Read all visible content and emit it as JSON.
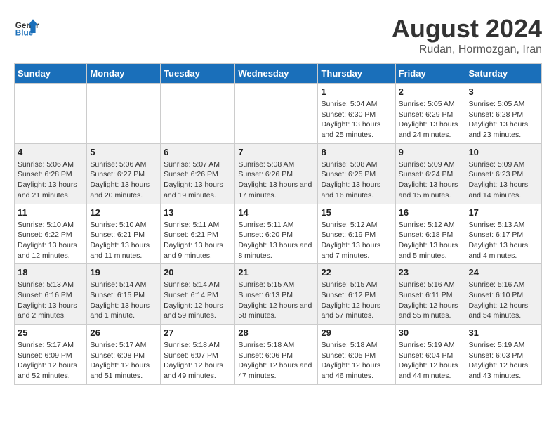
{
  "header": {
    "logo_line1": "General",
    "logo_line2": "Blue",
    "main_title": "August 2024",
    "subtitle": "Rudan, Hormozgan, Iran"
  },
  "calendar": {
    "weekdays": [
      "Sunday",
      "Monday",
      "Tuesday",
      "Wednesday",
      "Thursday",
      "Friday",
      "Saturday"
    ],
    "weeks": [
      [
        {
          "day": "",
          "info": ""
        },
        {
          "day": "",
          "info": ""
        },
        {
          "day": "",
          "info": ""
        },
        {
          "day": "",
          "info": ""
        },
        {
          "day": "1",
          "info": "Sunrise: 5:04 AM\nSunset: 6:30 PM\nDaylight: 13 hours and 25 minutes."
        },
        {
          "day": "2",
          "info": "Sunrise: 5:05 AM\nSunset: 6:29 PM\nDaylight: 13 hours and 24 minutes."
        },
        {
          "day": "3",
          "info": "Sunrise: 5:05 AM\nSunset: 6:28 PM\nDaylight: 13 hours and 23 minutes."
        }
      ],
      [
        {
          "day": "4",
          "info": "Sunrise: 5:06 AM\nSunset: 6:28 PM\nDaylight: 13 hours and 21 minutes."
        },
        {
          "day": "5",
          "info": "Sunrise: 5:06 AM\nSunset: 6:27 PM\nDaylight: 13 hours and 20 minutes."
        },
        {
          "day": "6",
          "info": "Sunrise: 5:07 AM\nSunset: 6:26 PM\nDaylight: 13 hours and 19 minutes."
        },
        {
          "day": "7",
          "info": "Sunrise: 5:08 AM\nSunset: 6:26 PM\nDaylight: 13 hours and 17 minutes."
        },
        {
          "day": "8",
          "info": "Sunrise: 5:08 AM\nSunset: 6:25 PM\nDaylight: 13 hours and 16 minutes."
        },
        {
          "day": "9",
          "info": "Sunrise: 5:09 AM\nSunset: 6:24 PM\nDaylight: 13 hours and 15 minutes."
        },
        {
          "day": "10",
          "info": "Sunrise: 5:09 AM\nSunset: 6:23 PM\nDaylight: 13 hours and 14 minutes."
        }
      ],
      [
        {
          "day": "11",
          "info": "Sunrise: 5:10 AM\nSunset: 6:22 PM\nDaylight: 13 hours and 12 minutes."
        },
        {
          "day": "12",
          "info": "Sunrise: 5:10 AM\nSunset: 6:21 PM\nDaylight: 13 hours and 11 minutes."
        },
        {
          "day": "13",
          "info": "Sunrise: 5:11 AM\nSunset: 6:21 PM\nDaylight: 13 hours and 9 minutes."
        },
        {
          "day": "14",
          "info": "Sunrise: 5:11 AM\nSunset: 6:20 PM\nDaylight: 13 hours and 8 minutes."
        },
        {
          "day": "15",
          "info": "Sunrise: 5:12 AM\nSunset: 6:19 PM\nDaylight: 13 hours and 7 minutes."
        },
        {
          "day": "16",
          "info": "Sunrise: 5:12 AM\nSunset: 6:18 PM\nDaylight: 13 hours and 5 minutes."
        },
        {
          "day": "17",
          "info": "Sunrise: 5:13 AM\nSunset: 6:17 PM\nDaylight: 13 hours and 4 minutes."
        }
      ],
      [
        {
          "day": "18",
          "info": "Sunrise: 5:13 AM\nSunset: 6:16 PM\nDaylight: 13 hours and 2 minutes."
        },
        {
          "day": "19",
          "info": "Sunrise: 5:14 AM\nSunset: 6:15 PM\nDaylight: 13 hours and 1 minute."
        },
        {
          "day": "20",
          "info": "Sunrise: 5:14 AM\nSunset: 6:14 PM\nDaylight: 12 hours and 59 minutes."
        },
        {
          "day": "21",
          "info": "Sunrise: 5:15 AM\nSunset: 6:13 PM\nDaylight: 12 hours and 58 minutes."
        },
        {
          "day": "22",
          "info": "Sunrise: 5:15 AM\nSunset: 6:12 PM\nDaylight: 12 hours and 57 minutes."
        },
        {
          "day": "23",
          "info": "Sunrise: 5:16 AM\nSunset: 6:11 PM\nDaylight: 12 hours and 55 minutes."
        },
        {
          "day": "24",
          "info": "Sunrise: 5:16 AM\nSunset: 6:10 PM\nDaylight: 12 hours and 54 minutes."
        }
      ],
      [
        {
          "day": "25",
          "info": "Sunrise: 5:17 AM\nSunset: 6:09 PM\nDaylight: 12 hours and 52 minutes."
        },
        {
          "day": "26",
          "info": "Sunrise: 5:17 AM\nSunset: 6:08 PM\nDaylight: 12 hours and 51 minutes."
        },
        {
          "day": "27",
          "info": "Sunrise: 5:18 AM\nSunset: 6:07 PM\nDaylight: 12 hours and 49 minutes."
        },
        {
          "day": "28",
          "info": "Sunrise: 5:18 AM\nSunset: 6:06 PM\nDaylight: 12 hours and 47 minutes."
        },
        {
          "day": "29",
          "info": "Sunrise: 5:18 AM\nSunset: 6:05 PM\nDaylight: 12 hours and 46 minutes."
        },
        {
          "day": "30",
          "info": "Sunrise: 5:19 AM\nSunset: 6:04 PM\nDaylight: 12 hours and 44 minutes."
        },
        {
          "day": "31",
          "info": "Sunrise: 5:19 AM\nSunset: 6:03 PM\nDaylight: 12 hours and 43 minutes."
        }
      ]
    ]
  }
}
